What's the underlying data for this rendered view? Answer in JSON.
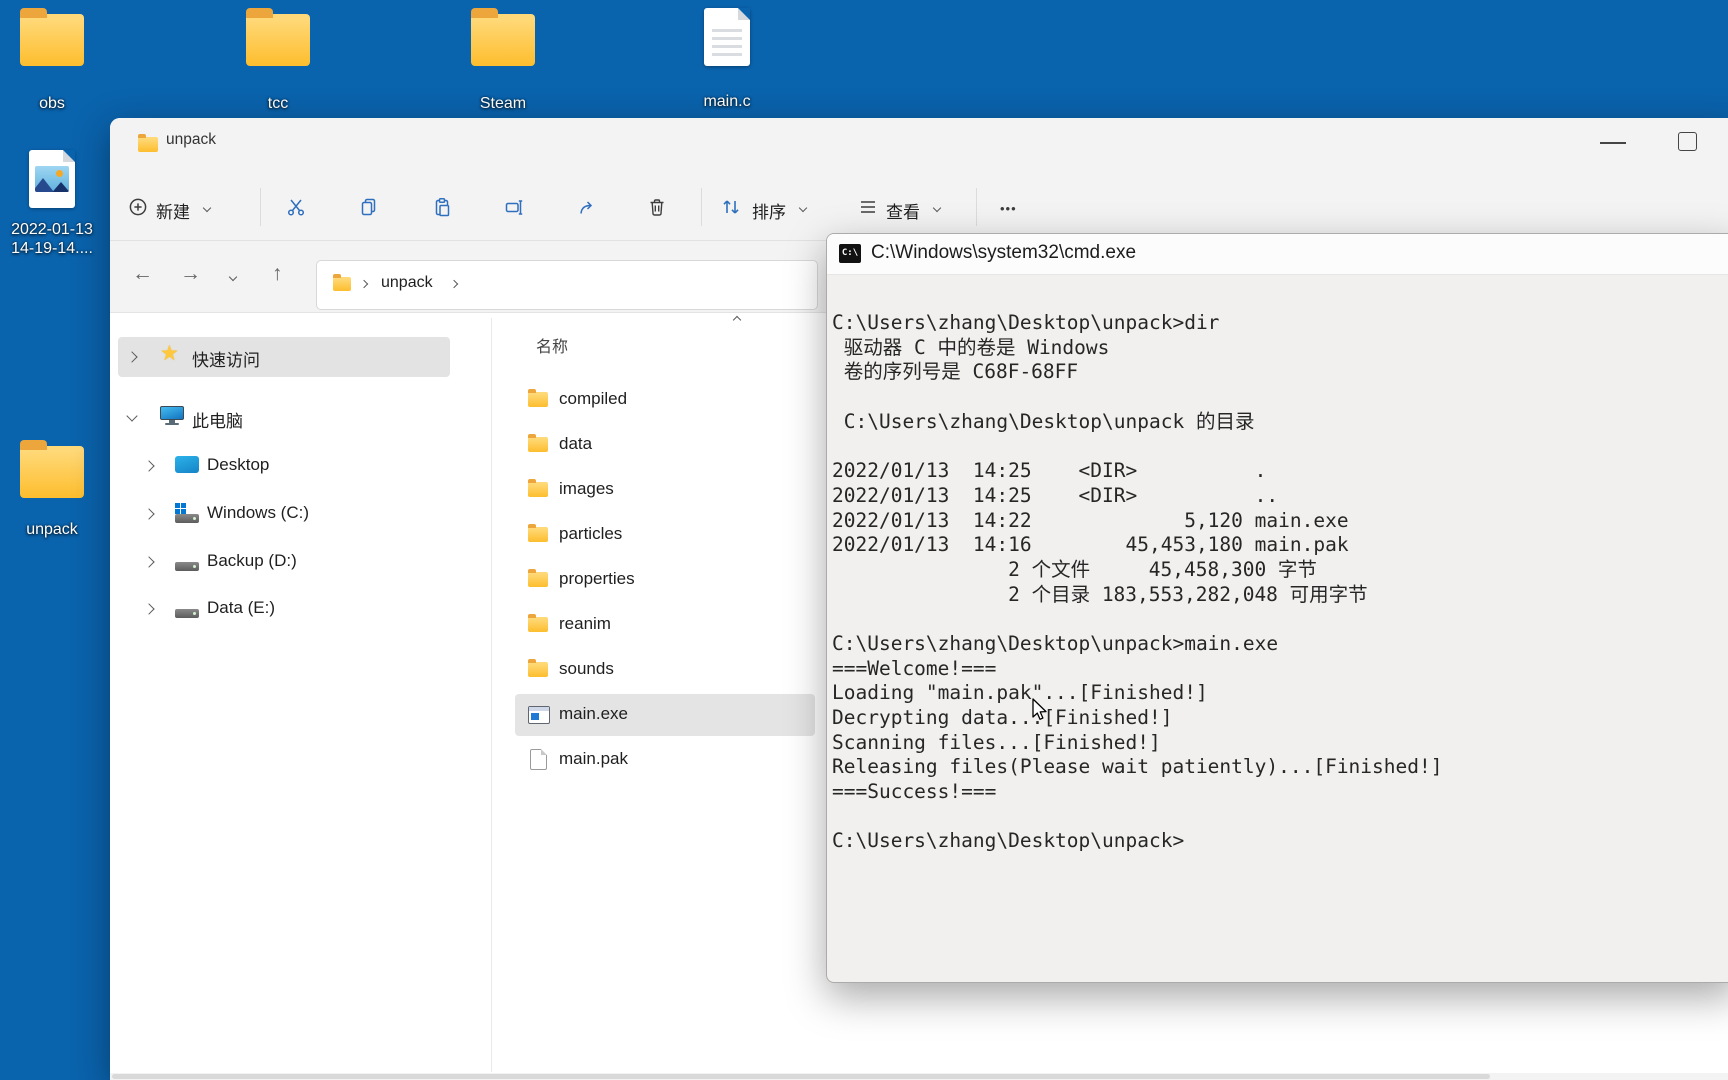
{
  "desktop": {
    "icons": [
      {
        "label": "obs"
      },
      {
        "label": "tcc"
      },
      {
        "label": "Steam"
      },
      {
        "label": "main.c"
      },
      {
        "label": "2022-01-13\n14-19-14...."
      },
      {
        "label": "unpack"
      }
    ]
  },
  "explorer": {
    "tab_title": "unpack",
    "toolbar": {
      "new_label": "新建",
      "sort_label": "排序",
      "view_label": "查看",
      "more_label": "•••"
    },
    "breadcrumb": {
      "folder": "unpack"
    },
    "sidebar": {
      "quick_access": "快速访问",
      "this_pc": "此电脑",
      "items": [
        "Desktop",
        "Windows (C:)",
        "Backup (D:)",
        "Data (E:)"
      ]
    },
    "filelist": {
      "name_header": "名称",
      "folders": [
        "compiled",
        "data",
        "images",
        "particles",
        "properties",
        "reanim",
        "sounds"
      ],
      "exe": "main.exe",
      "pak": "main.pak"
    }
  },
  "cmd": {
    "title": "C:\\Windows\\system32\\cmd.exe",
    "icon_text": "C:\\",
    "lines": [
      "C:\\Users\\zhang\\Desktop\\unpack>dir",
      " 驱动器 C 中的卷是 Windows",
      " 卷的序列号是 C68F-68FF",
      "",
      " C:\\Users\\zhang\\Desktop\\unpack 的目录",
      "",
      "2022/01/13  14:25    <DIR>          .",
      "2022/01/13  14:25    <DIR>          ..",
      "2022/01/13  14:22             5,120 main.exe",
      "2022/01/13  14:16        45,453,180 main.pak",
      "               2 个文件     45,458,300 字节",
      "               2 个目录 183,553,282,048 可用字节",
      "",
      "C:\\Users\\zhang\\Desktop\\unpack>main.exe",
      "===Welcome!===",
      "Loading \"main.pak\"...[Finished!]",
      "Decrypting data...[Finished!]",
      "Scanning files...[Finished!]",
      "Releasing files(Please wait patiently)...[Finished!]",
      "===Success!===",
      "",
      "C:\\Users\\zhang\\Desktop\\unpack>"
    ]
  }
}
